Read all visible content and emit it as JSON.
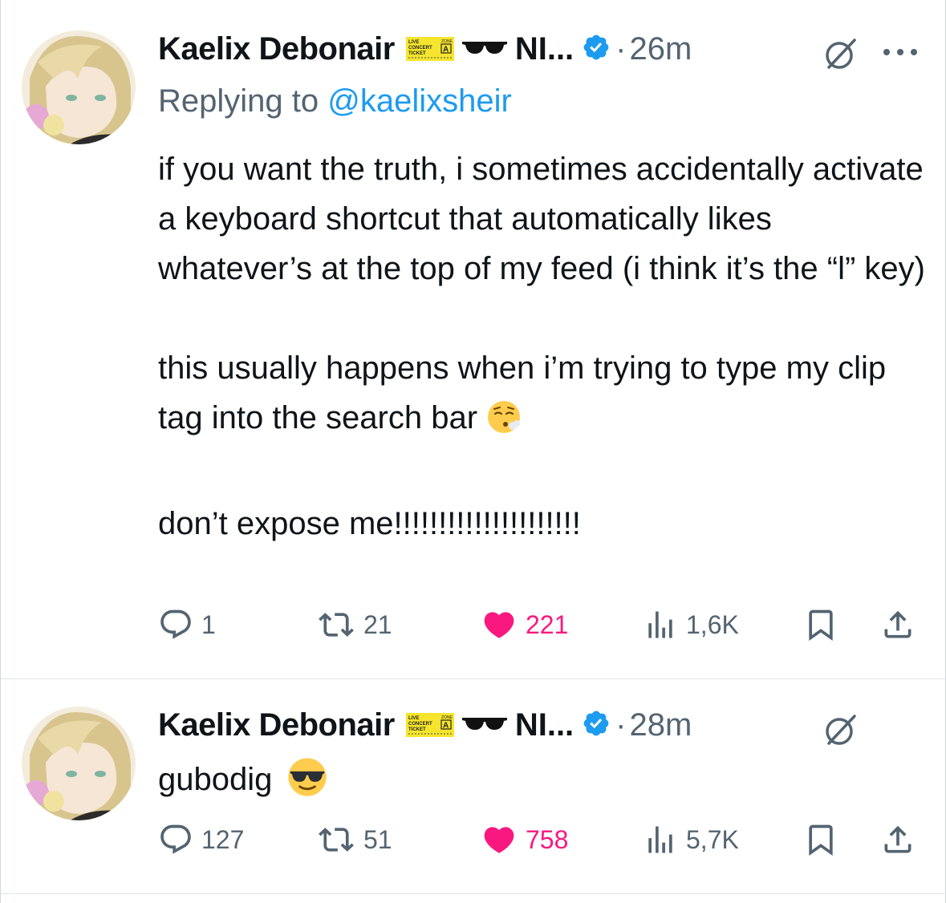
{
  "tweets": [
    {
      "author": "Kaelix Debonair",
      "name_suffix": "NI...",
      "time": "26m",
      "replying_prefix": "Replying to",
      "replying_handle": "@kaelixsheir",
      "paragraphs": [
        "if you want the truth, i sometimes accidentally activate a keyboard shortcut that automatically likes whatever’s at the top of my feed (i think it’s the “l” key)",
        "this usually happens when i’m trying to type my clip tag into the search bar",
        "don’t expose me!!!!!!!!!!!!!!!!!!!!!"
      ],
      "stats": {
        "replies": "1",
        "reposts": "21",
        "likes": "221",
        "views": "1,6K"
      }
    },
    {
      "author": "Kaelix Debonair",
      "name_suffix": "NI...",
      "time": "28m",
      "text": "gubodig",
      "stats": {
        "replies": "127",
        "reposts": "51",
        "likes": "758",
        "views": "5,7K"
      }
    }
  ],
  "badge": {
    "ticket_lines": [
      "LIVE",
      "CONCERT",
      "TICKET",
      "ZONE",
      "A"
    ],
    "ticket_color": "#f5e52d"
  },
  "icons": {
    "verified": "verified-badge-icon",
    "grok": "grok-icon",
    "more": "more-icon",
    "reply": "reply-icon",
    "repost": "repost-icon",
    "like": "heart-icon",
    "views": "views-icon",
    "bookmark": "bookmark-icon",
    "share": "share-icon",
    "emoji_sigh": "face-exhaling-emoji",
    "emoji_cool": "sunglasses-face-emoji",
    "sunglasses": "sunglasses-emoji"
  },
  "colors": {
    "text": "#0f1419",
    "secondary": "#536471",
    "link": "#1d9bf0",
    "like": "#f91880",
    "verified": "#1d9bf0"
  }
}
